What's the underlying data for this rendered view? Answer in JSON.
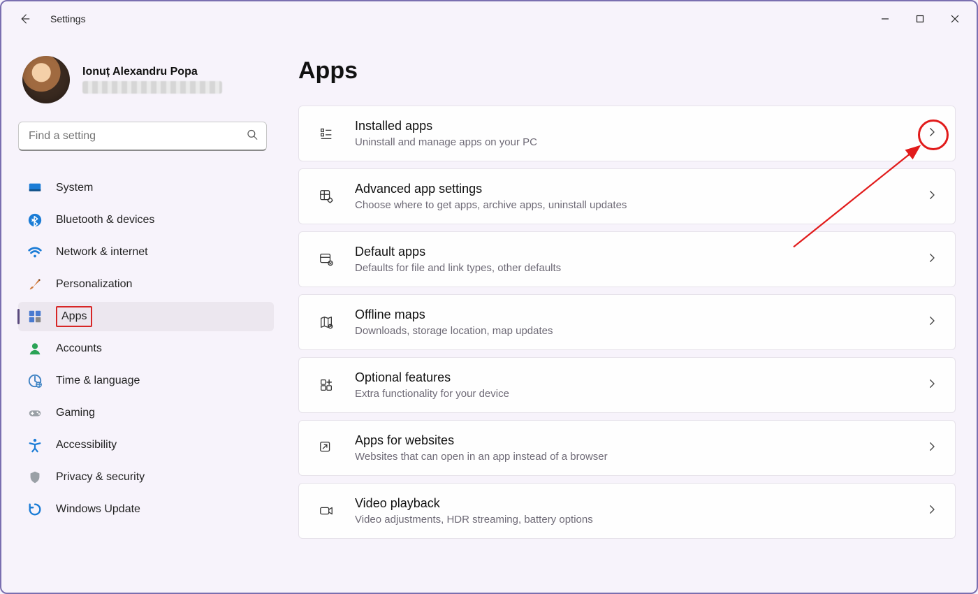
{
  "window": {
    "title": "Settings"
  },
  "profile": {
    "name": "Ionuț Alexandru Popa"
  },
  "search": {
    "placeholder": "Find a setting"
  },
  "nav": {
    "items": [
      {
        "label": "System",
        "icon": "system",
        "key": "system"
      },
      {
        "label": "Bluetooth & devices",
        "icon": "bluetooth",
        "key": "bluetooth"
      },
      {
        "label": "Network & internet",
        "icon": "wifi",
        "key": "network"
      },
      {
        "label": "Personalization",
        "icon": "paintbrush",
        "key": "personalization"
      },
      {
        "label": "Apps",
        "icon": "apps",
        "key": "apps"
      },
      {
        "label": "Accounts",
        "icon": "person",
        "key": "accounts"
      },
      {
        "label": "Time & language",
        "icon": "clock-globe",
        "key": "time"
      },
      {
        "label": "Gaming",
        "icon": "gamepad",
        "key": "gaming"
      },
      {
        "label": "Accessibility",
        "icon": "accessibility",
        "key": "accessibility"
      },
      {
        "label": "Privacy & security",
        "icon": "shield",
        "key": "privacy"
      },
      {
        "label": "Windows Update",
        "icon": "update",
        "key": "update"
      }
    ],
    "active_key": "apps"
  },
  "page": {
    "title": "Apps"
  },
  "cards": [
    {
      "title": "Installed apps",
      "subtitle": "Uninstall and manage apps on your PC",
      "icon": "list",
      "key": "installed"
    },
    {
      "title": "Advanced app settings",
      "subtitle": "Choose where to get apps, archive apps, uninstall updates",
      "icon": "app-gear",
      "key": "advanced"
    },
    {
      "title": "Default apps",
      "subtitle": "Defaults for file and link types, other defaults",
      "icon": "app-default",
      "key": "defaults"
    },
    {
      "title": "Offline maps",
      "subtitle": "Downloads, storage location, map updates",
      "icon": "map",
      "key": "maps"
    },
    {
      "title": "Optional features",
      "subtitle": "Extra functionality for your device",
      "icon": "app-plus",
      "key": "optional"
    },
    {
      "title": "Apps for websites",
      "subtitle": "Websites that can open in an app instead of a browser",
      "icon": "app-link",
      "key": "websites"
    },
    {
      "title": "Video playback",
      "subtitle": "Video adjustments, HDR streaming, battery options",
      "icon": "video",
      "key": "video"
    }
  ],
  "annotations": {
    "circle_target_card_key": "installed",
    "highlight_nav_key": "apps"
  }
}
